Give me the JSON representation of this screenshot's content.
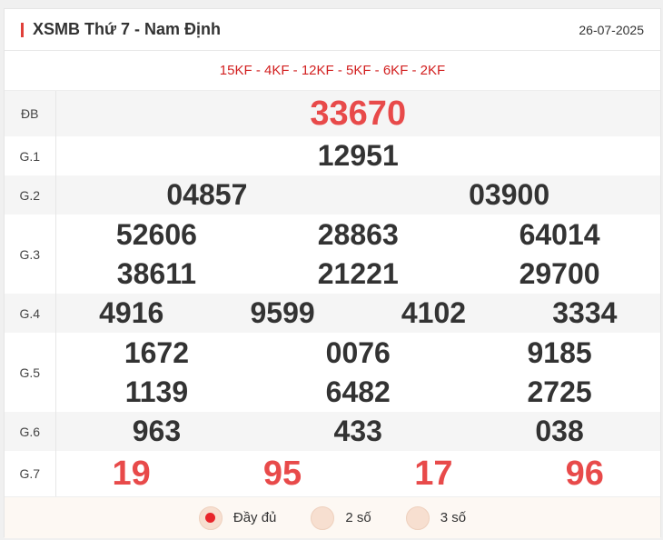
{
  "header": {
    "title": "XSMB Thứ 7 - Nam Định",
    "date": "26-07-2025"
  },
  "codes": "15KF - 4KF - 12KF - 5KF - 6KF - 2KF",
  "prizes": {
    "db": {
      "label": "ĐB",
      "values": [
        "33670"
      ]
    },
    "g1": {
      "label": "G.1",
      "values": [
        "12951"
      ]
    },
    "g2": {
      "label": "G.2",
      "values": [
        "04857",
        "03900"
      ]
    },
    "g3": {
      "label": "G.3",
      "values": [
        "52606",
        "28863",
        "64014",
        "38611",
        "21221",
        "29700"
      ]
    },
    "g4": {
      "label": "G.4",
      "values": [
        "4916",
        "9599",
        "4102",
        "3334"
      ]
    },
    "g5": {
      "label": "G.5",
      "values": [
        "1672",
        "0076",
        "9185",
        "1139",
        "6482",
        "2725"
      ]
    },
    "g6": {
      "label": "G.6",
      "values": [
        "963",
        "433",
        "038"
      ]
    },
    "g7": {
      "label": "G.7",
      "values": [
        "19",
        "95",
        "17",
        "96"
      ]
    }
  },
  "footer": {
    "options": [
      {
        "label": "Đầy đủ",
        "selected": true
      },
      {
        "label": "2 số",
        "selected": false
      },
      {
        "label": "3 số",
        "selected": false
      }
    ]
  },
  "colors": {
    "accent": "#e84a4a",
    "codes": "#d21f1f",
    "radio_on": "#e8252a",
    "radio_bg": "#f7dfd0"
  }
}
